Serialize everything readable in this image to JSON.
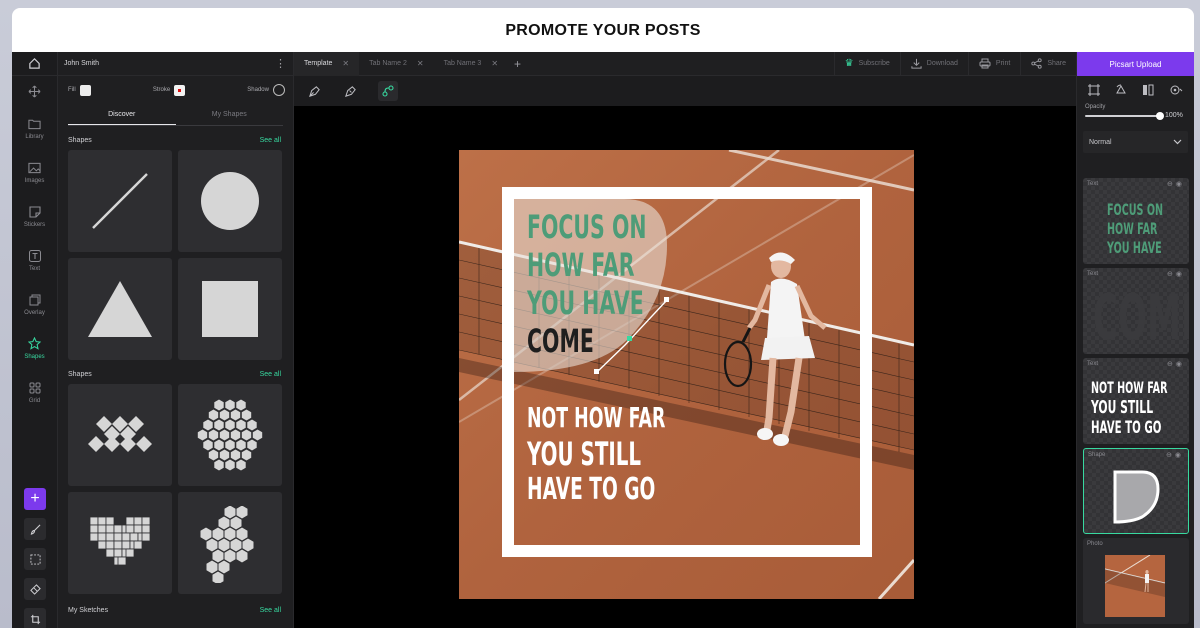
{
  "banner": {
    "title": "PROMOTE YOUR POSTS"
  },
  "rail": {
    "items": [
      {
        "label": "Library",
        "icon": "folder-icon"
      },
      {
        "label": "Images",
        "icon": "image-icon"
      },
      {
        "label": "Stickers",
        "icon": "sticker-icon"
      },
      {
        "label": "Text",
        "icon": "text-icon"
      },
      {
        "label": "Overlay",
        "icon": "overlay-icon"
      },
      {
        "label": "Shapes",
        "icon": "star-icon",
        "active": true
      },
      {
        "label": "Grid",
        "icon": "grid-icon"
      }
    ]
  },
  "left_panel": {
    "user": "John Smith",
    "props": {
      "fill": "Fill",
      "stroke": "Stroke",
      "shadow": "Shadow"
    },
    "tabs": [
      "Discover",
      "My Shapes"
    ],
    "sections": [
      {
        "title": "Shapes",
        "see_all": "See all"
      },
      {
        "title": "Shapes",
        "see_all": "See all"
      },
      {
        "title": "My Sketches",
        "see_all": "See all"
      }
    ]
  },
  "doc_tabs": [
    {
      "label": "Template",
      "active": true
    },
    {
      "label": "Tab Name 2"
    },
    {
      "label": "Tab Name 3"
    }
  ],
  "actions": {
    "subscribe": "Subscribe",
    "download": "Download",
    "print": "Print",
    "share": "Share"
  },
  "right_panel": {
    "upload": "Picsart Upload",
    "opacity_label": "Opacity",
    "opacity_value": "100%",
    "opacity": 1.0,
    "blend_mode": "Normal",
    "layers": [
      {
        "label": "Text",
        "preview": [
          "FOCUS ON",
          "HOW FAR",
          "YOU HAVE"
        ]
      },
      {
        "label": "Text",
        "preview": [
          "COME"
        ]
      },
      {
        "label": "Text",
        "preview": [
          "NOT HOW FAR",
          "YOU STILL",
          "HAVE TO GO"
        ]
      },
      {
        "label": "Shape"
      },
      {
        "label": "Photo"
      }
    ]
  },
  "design": {
    "quote_top": [
      "FOCUS ON",
      "HOW FAR",
      "YOU HAVE",
      "COME"
    ],
    "quote_bottom": [
      "NOT HOW FAR",
      "YOU STILL",
      "HAVE TO GO"
    ]
  },
  "colors": {
    "accent_green": "#38d9a0",
    "accent_purple": "#7c3aed",
    "quote_green": "#4e9c78",
    "court": "#b56a44"
  }
}
